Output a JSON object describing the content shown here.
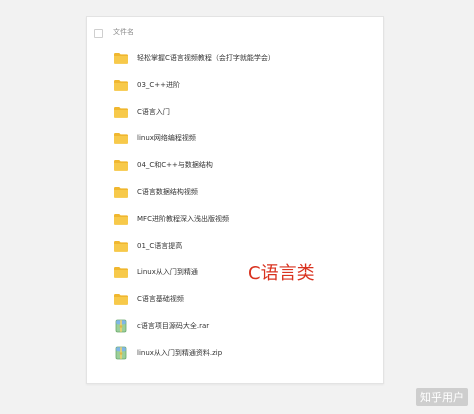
{
  "file_list": {
    "header_label": "文件名",
    "items": [
      {
        "type": "folder",
        "name": "轻松掌握C语言视频教程（会打字就能学会）"
      },
      {
        "type": "folder",
        "name": "03_C++进阶"
      },
      {
        "type": "folder",
        "name": "C语言入门"
      },
      {
        "type": "folder",
        "name": "linux网络编程视频"
      },
      {
        "type": "folder",
        "name": "04_C和C++与数据结构"
      },
      {
        "type": "folder",
        "name": "C语言数据结构视频"
      },
      {
        "type": "folder",
        "name": "MFC进阶教程深入浅出版视频"
      },
      {
        "type": "folder",
        "name": "01_C语言提高"
      },
      {
        "type": "folder",
        "name": "Linux从入门到精通"
      },
      {
        "type": "folder",
        "name": "C语言基础视频"
      },
      {
        "type": "archive",
        "name": "c语言项目源码大全.rar"
      },
      {
        "type": "archive",
        "name": "linux从入门到精通资料.zip"
      }
    ]
  },
  "overlay_label": "C语言类",
  "watermark": "知乎用户",
  "colors": {
    "folder_yellow": "#f7c94a",
    "folder_yellow_dark": "#f0b72f",
    "overlay_red": "#d9321f"
  }
}
